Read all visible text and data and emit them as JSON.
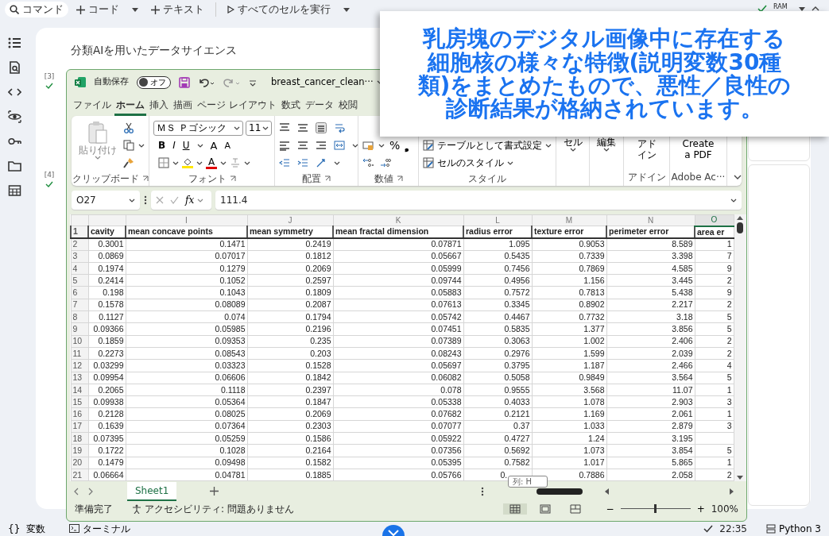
{
  "toolbar": [
    {
      "kind": "search",
      "label": "コマンド"
    },
    {
      "kind": "add",
      "label": "コード"
    },
    {
      "kind": "dropdown"
    },
    {
      "kind": "add",
      "label": "テキスト"
    },
    {
      "kind": "run",
      "label": "すべてのセルを実行"
    },
    {
      "kind": "dropdown"
    }
  ],
  "resources": {
    "label": "RAM",
    "connected": true
  },
  "notebook": {
    "heading": "分類AIを用いたデータサイエンス",
    "cells": [
      {
        "number": "[3]",
        "done": true
      },
      {
        "number": "[4]",
        "done": true
      }
    ]
  },
  "excel": {
    "autosave_label": "自動保存",
    "autosave": {
      "on": false,
      "label": "オフ"
    },
    "filename": "breast_cancer_clean···",
    "tabs": [
      {
        "label": "ファイル",
        "selected": false
      },
      {
        "label": "ホーム",
        "selected": true
      },
      {
        "label": "挿入",
        "selected": false
      },
      {
        "label": "描画",
        "selected": false
      },
      {
        "label": "ページ レイアウト",
        "selected": false
      },
      {
        "label": "数式",
        "selected": false
      },
      {
        "label": "データ",
        "selected": false
      },
      {
        "label": "校閲",
        "selected": false
      }
    ],
    "ribbon": [
      {
        "kind": "clipboard",
        "label": "クリップボード",
        "button": "貼り付け"
      },
      {
        "kind": "font",
        "label": "フォント",
        "font_name": "ＭＳ Ｐゴシック",
        "font_size": "11",
        "styles": [
          "B",
          "I",
          "U"
        ],
        "grow": "A",
        "shrink": "A",
        "color_glyph": "A"
      },
      {
        "kind": "alignment",
        "label": "配置"
      },
      {
        "kind": "number",
        "label": "数値",
        "percent": "%",
        "comma": "❟"
      },
      {
        "kind": "styles",
        "label": "スタイル",
        "commands": [
          "テーブルとして書式設定",
          "セルのスタイル"
        ]
      },
      {
        "kind": "command",
        "button": "セル"
      },
      {
        "kind": "command",
        "button": "編集"
      },
      {
        "kind": "addin",
        "label": "アドイン",
        "button_lines": [
          "アド",
          "イン"
        ]
      },
      {
        "kind": "addin",
        "label": "Adobe Ac···",
        "button_lines": [
          "Create",
          "a PDF"
        ]
      }
    ],
    "name_box": "O27",
    "function_label": "fx",
    "formula": "111.4",
    "columns": [
      {
        "header": "cavity",
        "selected": false
      },
      {
        "letter": "I",
        "header": "mean concave points",
        "selected": false
      },
      {
        "letter": "J",
        "header": "mean symmetry",
        "selected": false
      },
      {
        "letter": "K",
        "header": "mean fractal dimension",
        "selected": false
      },
      {
        "letter": "L",
        "header": "radius error",
        "selected": false
      },
      {
        "letter": "M",
        "header": "texture error",
        "selected": false
      },
      {
        "letter": "N",
        "header": "perimeter error",
        "selected": false
      },
      {
        "letter": "O",
        "header": "area er",
        "selected": true
      }
    ],
    "header_row": "1",
    "rows": [
      {
        "number": "2",
        "cells": [
          "0.3001",
          "0.1471",
          "0.2419",
          "0.07871",
          "1.095",
          "0.9053",
          "8.589",
          "1"
        ]
      },
      {
        "number": "3",
        "cells": [
          "0.0869",
          "0.07017",
          "0.1812",
          "0.05667",
          "0.5435",
          "0.7339",
          "3.398",
          "7"
        ]
      },
      {
        "number": "4",
        "cells": [
          "0.1974",
          "0.1279",
          "0.2069",
          "0.05999",
          "0.7456",
          "0.7869",
          "4.585",
          "9"
        ]
      },
      {
        "number": "5",
        "cells": [
          "0.2414",
          "0.1052",
          "0.2597",
          "0.09744",
          "0.4956",
          "1.156",
          "3.445",
          "2"
        ]
      },
      {
        "number": "6",
        "cells": [
          "0.198",
          "0.1043",
          "0.1809",
          "0.05883",
          "0.7572",
          "0.7813",
          "5.438",
          "9"
        ]
      },
      {
        "number": "7",
        "cells": [
          "0.1578",
          "0.08089",
          "0.2087",
          "0.07613",
          "0.3345",
          "0.8902",
          "2.217",
          "2"
        ]
      },
      {
        "number": "8",
        "cells": [
          "0.1127",
          "0.074",
          "0.1794",
          "0.05742",
          "0.4467",
          "0.7732",
          "3.18",
          "5"
        ]
      },
      {
        "number": "9",
        "cells": [
          "0.09366",
          "0.05985",
          "0.2196",
          "0.07451",
          "0.5835",
          "1.377",
          "3.856",
          "5"
        ]
      },
      {
        "number": "10",
        "cells": [
          "0.1859",
          "0.09353",
          "0.235",
          "0.07389",
          "0.3063",
          "1.002",
          "2.406",
          "2"
        ]
      },
      {
        "number": "11",
        "cells": [
          "0.2273",
          "0.08543",
          "0.203",
          "0.08243",
          "0.2976",
          "1.599",
          "2.039",
          "2"
        ]
      },
      {
        "number": "12",
        "cells": [
          "0.03299",
          "0.03323",
          "0.1528",
          "0.05697",
          "0.3795",
          "1.187",
          "2.466",
          "4"
        ]
      },
      {
        "number": "13",
        "cells": [
          "0.09954",
          "0.06606",
          "0.1842",
          "0.06082",
          "0.5058",
          "0.9849",
          "3.564",
          "5"
        ]
      },
      {
        "number": "14",
        "cells": [
          "0.2065",
          "0.1118",
          "0.2397",
          "0.078",
          "0.9555",
          "3.568",
          "11.07",
          "1"
        ]
      },
      {
        "number": "15",
        "cells": [
          "0.09938",
          "0.05364",
          "0.1847",
          "0.05338",
          "0.4033",
          "1.078",
          "2.903",
          "3"
        ]
      },
      {
        "number": "16",
        "cells": [
          "0.2128",
          "0.08025",
          "0.2069",
          "0.07682",
          "0.2121",
          "1.169",
          "2.061",
          "1"
        ]
      },
      {
        "number": "17",
        "cells": [
          "0.1639",
          "0.07364",
          "0.2303",
          "0.07077",
          "0.37",
          "1.033",
          "2.879",
          "3"
        ]
      },
      {
        "number": "18",
        "cells": [
          "0.07395",
          "0.05259",
          "0.1586",
          "0.05922",
          "0.4727",
          "1.24",
          "3.195",
          null
        ]
      },
      {
        "number": "19",
        "cells": [
          "0.1722",
          "0.1028",
          "0.2164",
          "0.07356",
          "0.5692",
          "1.073",
          "3.854",
          "5"
        ]
      },
      {
        "number": "20",
        "cells": [
          "0.1479",
          "0.09498",
          "0.1582",
          "0.05395",
          "0.7582",
          "1.017",
          "5.865",
          "1"
        ]
      },
      {
        "number": "21",
        "cells": [
          "0.06664",
          "0.04781",
          "0.1885",
          "0.05766",
          {
            "text": "0.",
            "covered": true
          },
          "0.7886",
          "2.058",
          "2"
        ]
      }
    ],
    "tooltip": "列: H",
    "sheets": [
      {
        "name": "Sheet1",
        "selected": true
      }
    ],
    "status": "準備完了",
    "accessibility": "アクセシビリティ: 問題ありません",
    "views": [
      {
        "kind": "normal",
        "selected": true
      },
      {
        "kind": "page_layout",
        "selected": false
      },
      {
        "kind": "page_break",
        "selected": false
      }
    ],
    "zoom": {
      "minus": "−",
      "plus": "+",
      "level": 0.5,
      "reading": "100%"
    }
  },
  "callout": {
    "lines": [
      "乳房塊のデジタル画像中に存在する",
      "細胞核の様々な特徴(説明変数30種",
      "類)をまとめたもので、悪性／良性の",
      "診断結果が格納されています。"
    ]
  },
  "bottom_bar": {
    "variables_glyph": "{}",
    "variables": "変数",
    "terminal": "ターミナル",
    "done": true,
    "time": "22:35",
    "runtime": "Python 3"
  }
}
